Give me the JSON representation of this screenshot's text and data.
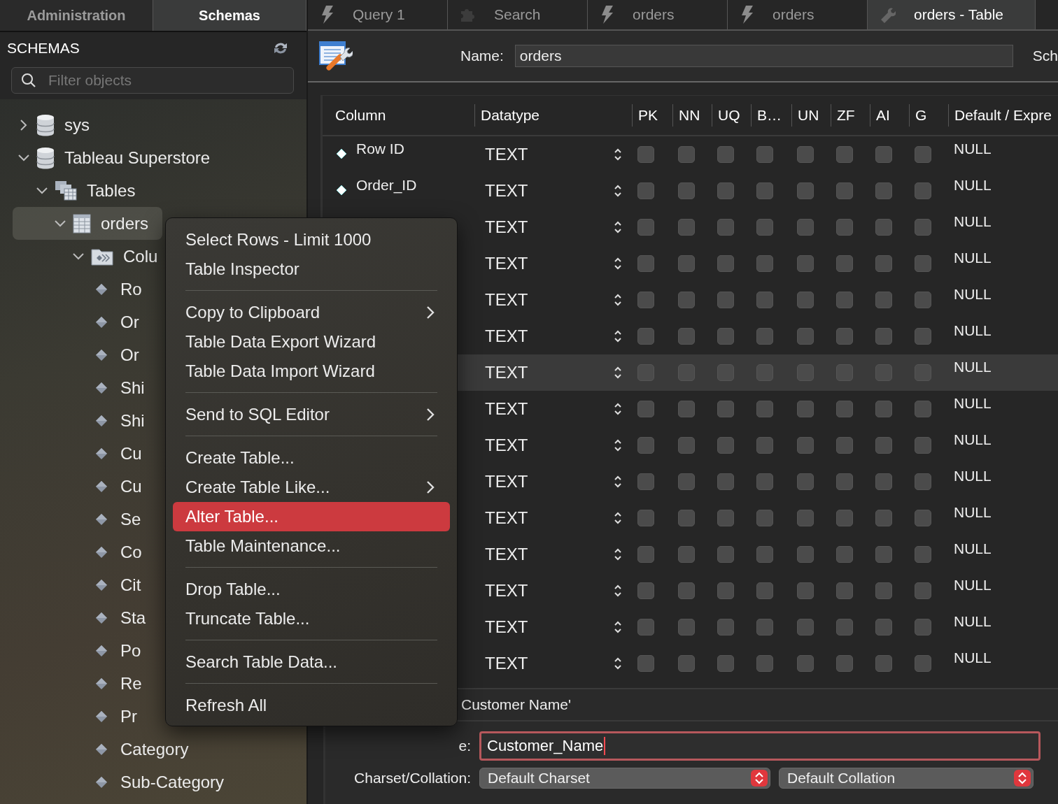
{
  "left_tabs": [
    {
      "label": "Administration",
      "selected": false
    },
    {
      "label": "Schemas",
      "selected": true
    }
  ],
  "sidebar": {
    "title": "SCHEMAS",
    "filter": {
      "placeholder": "Filter objects"
    },
    "tree": [
      {
        "label": "sys",
        "kind": "database",
        "expanded": false,
        "selected": false
      },
      {
        "label": "Tableau Superstore",
        "kind": "database",
        "expanded": true,
        "selected": false,
        "children": [
          {
            "label": "Tables",
            "kind": "tables",
            "expanded": true,
            "selected": false,
            "children": [
              {
                "label": "orders",
                "kind": "table",
                "expanded": true,
                "selected": true,
                "children": [
                  {
                    "label": "Colu",
                    "kind": "columns",
                    "expanded": true,
                    "selected": false,
                    "children": [
                      {
                        "label": "Ro",
                        "kind": "column",
                        "selected": false
                      },
                      {
                        "label": "Or",
                        "kind": "column",
                        "selected": false
                      },
                      {
                        "label": "Or",
                        "kind": "column",
                        "selected": false
                      },
                      {
                        "label": "Shi",
                        "kind": "column",
                        "selected": false
                      },
                      {
                        "label": "Shi",
                        "kind": "column",
                        "selected": false
                      },
                      {
                        "label": "Cu",
                        "kind": "column",
                        "selected": false
                      },
                      {
                        "label": "Cu",
                        "kind": "column",
                        "selected": false
                      },
                      {
                        "label": "Se",
                        "kind": "column",
                        "selected": false
                      },
                      {
                        "label": "Co",
                        "kind": "column",
                        "selected": false
                      },
                      {
                        "label": "Cit",
                        "kind": "column",
                        "selected": false
                      },
                      {
                        "label": "Sta",
                        "kind": "column",
                        "selected": false
                      },
                      {
                        "label": "Po",
                        "kind": "column",
                        "selected": false
                      },
                      {
                        "label": "Re",
                        "kind": "column",
                        "selected": false
                      },
                      {
                        "label": "Pr",
                        "kind": "column",
                        "selected": false
                      },
                      {
                        "label": "Category",
                        "kind": "column",
                        "selected": false
                      },
                      {
                        "label": "Sub-Category",
                        "kind": "column",
                        "selected": false
                      }
                    ]
                  }
                ]
              }
            ]
          }
        ]
      }
    ]
  },
  "editor_tabs": [
    {
      "label": "Query 1",
      "kind": "query",
      "selected": false
    },
    {
      "label": "Search",
      "kind": "search",
      "selected": false
    },
    {
      "label": "orders",
      "kind": "query",
      "selected": false
    },
    {
      "label": "orders",
      "kind": "query",
      "selected": false
    },
    {
      "label": "orders - Table",
      "kind": "table",
      "selected": true
    }
  ],
  "table_editor": {
    "name_label": "Name:",
    "name_value": "orders",
    "schema_label": "Sch",
    "columns": [
      "Column",
      "Datatype",
      "PK",
      "NN",
      "UQ",
      "B…",
      "UN",
      "ZF",
      "AI",
      "G",
      "Default / Expre"
    ],
    "rows": [
      {
        "name": "Row ID",
        "datatype": "TEXT",
        "default": "NULL",
        "selected": false,
        "flags": [
          false,
          false,
          false,
          false,
          false,
          false,
          false,
          false
        ]
      },
      {
        "name": "Order_ID",
        "datatype": "TEXT",
        "default": "NULL",
        "selected": false,
        "flags": [
          false,
          false,
          false,
          false,
          false,
          false,
          false,
          false
        ]
      },
      {
        "datatype": "TEXT",
        "default": "NULL",
        "selected": false,
        "flags": [
          false,
          false,
          false,
          false,
          false,
          false,
          false,
          false
        ]
      },
      {
        "datatype": "TEXT",
        "default": "NULL",
        "selected": false,
        "flags": [
          false,
          false,
          false,
          false,
          false,
          false,
          false,
          false
        ]
      },
      {
        "datatype": "TEXT",
        "default": "NULL",
        "selected": false,
        "flags": [
          false,
          false,
          false,
          false,
          false,
          false,
          false,
          false
        ]
      },
      {
        "datatype": "TEXT",
        "default": "NULL",
        "selected": false,
        "flags": [
          false,
          false,
          false,
          false,
          false,
          false,
          false,
          false
        ]
      },
      {
        "datatype": "TEXT",
        "default": "NULL",
        "selected": true,
        "flags": [
          false,
          false,
          false,
          false,
          false,
          false,
          false,
          false
        ]
      },
      {
        "datatype": "TEXT",
        "default": "NULL",
        "selected": false,
        "flags": [
          false,
          false,
          false,
          false,
          false,
          false,
          false,
          false
        ]
      },
      {
        "datatype": "TEXT",
        "default": "NULL",
        "selected": false,
        "flags": [
          false,
          false,
          false,
          false,
          false,
          false,
          false,
          false
        ]
      },
      {
        "datatype": "TEXT",
        "default": "NULL",
        "selected": false,
        "flags": [
          false,
          false,
          false,
          false,
          false,
          false,
          false,
          false
        ]
      },
      {
        "datatype": "TEXT",
        "default": "NULL",
        "selected": false,
        "flags": [
          false,
          false,
          false,
          false,
          false,
          false,
          false,
          false
        ]
      },
      {
        "datatype": "TEXT",
        "default": "NULL",
        "selected": false,
        "flags": [
          false,
          false,
          false,
          false,
          false,
          false,
          false,
          false
        ]
      },
      {
        "datatype": "TEXT",
        "default": "NULL",
        "selected": false,
        "flags": [
          false,
          false,
          false,
          false,
          false,
          false,
          false,
          false
        ]
      },
      {
        "datatype": "TEXT",
        "default": "NULL",
        "selected": false,
        "flags": [
          false,
          false,
          false,
          false,
          false,
          false,
          false,
          false
        ]
      },
      {
        "datatype": "TEXT",
        "default": "NULL",
        "selected": false,
        "flags": [
          false,
          false,
          false,
          false,
          false,
          false,
          false,
          false
        ]
      }
    ],
    "details": {
      "caption": "Customer Name'",
      "name_label": "e:",
      "name_value": "Customer_Name",
      "focused": true,
      "charset_label": "Charset/Collation:",
      "charset": "Default Charset",
      "collation": "Default Collation"
    }
  },
  "context_menu": {
    "groups": [
      {
        "items": [
          {
            "label": "Select Rows - Limit 1000",
            "submenu": false,
            "selected": false
          },
          {
            "label": "Table Inspector",
            "submenu": false,
            "selected": false
          }
        ]
      },
      {
        "items": [
          {
            "label": "Copy to Clipboard",
            "submenu": true,
            "selected": false
          },
          {
            "label": "Table Data Export Wizard",
            "submenu": false,
            "selected": false
          },
          {
            "label": "Table Data Import Wizard",
            "submenu": false,
            "selected": false
          }
        ]
      },
      {
        "items": [
          {
            "label": "Send to SQL Editor",
            "submenu": true,
            "selected": false
          }
        ]
      },
      {
        "items": [
          {
            "label": "Create Table...",
            "submenu": false,
            "selected": false
          },
          {
            "label": "Create Table Like...",
            "submenu": true,
            "selected": false
          },
          {
            "label": "Alter Table...",
            "submenu": false,
            "selected": true
          },
          {
            "label": "Table Maintenance...",
            "submenu": false,
            "selected": false
          }
        ]
      },
      {
        "items": [
          {
            "label": "Drop Table...",
            "submenu": false,
            "selected": false
          },
          {
            "label": "Truncate Table...",
            "submenu": false,
            "selected": false
          }
        ]
      },
      {
        "items": [
          {
            "label": "Search Table Data...",
            "submenu": false,
            "selected": false
          }
        ]
      },
      {
        "items": [
          {
            "label": "Refresh All",
            "submenu": false,
            "selected": false
          }
        ]
      }
    ]
  }
}
